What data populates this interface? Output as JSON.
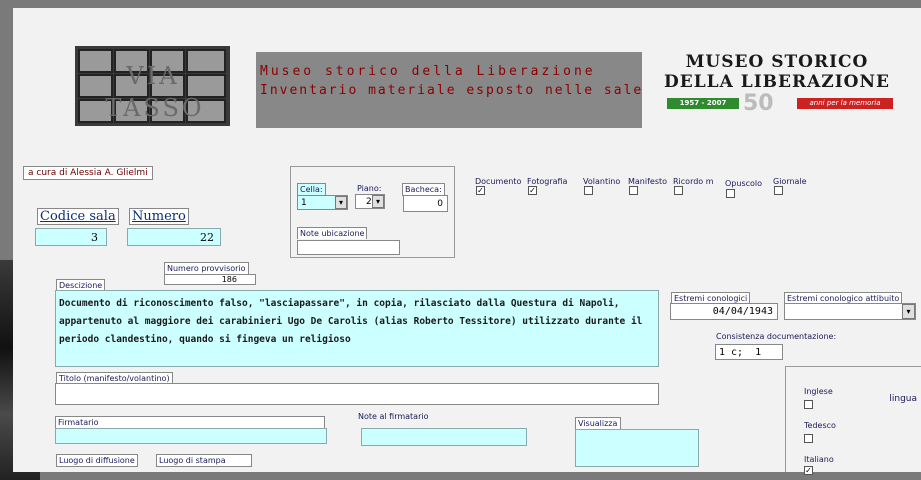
{
  "header": {
    "logo_text": "VIA TASSO",
    "title_line1": "Museo storico della Liberazione",
    "title_line2": "Inventario materiale esposto nelle sale",
    "brand": {
      "line1": "MUSEO STORICO",
      "line2": "DELLA LIBERAZIONE",
      "years": "1957 - 2007",
      "fifty": "50",
      "tagline": "anni per la memoria"
    }
  },
  "credit": "a cura di Alessia A. Glielmi",
  "location": {
    "cella_label": "Cella:",
    "cella_value": "1",
    "piano_label": "Piano:",
    "piano_value": "2",
    "bacheca_label": "Bacheca:",
    "bacheca_value": "0",
    "note_label": "Note ubicazione",
    "note_value": ""
  },
  "categories": [
    {
      "label": "Documento",
      "checked": true
    },
    {
      "label": "Fotografia",
      "checked": true
    },
    {
      "label": "Volantino",
      "checked": false
    },
    {
      "label": "Manifesto",
      "checked": false
    },
    {
      "label": "Ricordo m",
      "checked": false
    },
    {
      "label": "Opuscolo",
      "checked": false
    },
    {
      "label": "Giornale",
      "checked": false
    }
  ],
  "codice": {
    "label": "Codice sala",
    "value": "3"
  },
  "numero": {
    "label": "Numero",
    "value": "22"
  },
  "numero_provvisorio": {
    "label": "Numero provvisorio",
    "value": "186"
  },
  "descrizione": {
    "label": "Descizione",
    "text": "Documento di riconoscimento falso, \"lasciapassare\", in copia, rilasciato dalla Questura di Napoli, appartenuto al maggiore dei carabinieri Ugo De Carolis (alias Roberto Tessitore) utilizzato durante il periodo clandestino, quando si fingeva un religioso"
  },
  "estremi": {
    "label": "Estremi conologici",
    "value": "04/04/1943"
  },
  "estremi_attrib": {
    "label": "Estremi conologico attibuito",
    "value": ""
  },
  "consistenza": {
    "label": "Consistenza documentazione:",
    "value": "1 c;  1"
  },
  "titolo": {
    "label": "Titolo (manifesto/volantino)",
    "value": ""
  },
  "firmatario": {
    "label": "Firmatario",
    "value": ""
  },
  "note_firmatario": {
    "label": "Note al firmatario",
    "value": ""
  },
  "visualizza": {
    "label": "Visualizza"
  },
  "luogo_diffusione": {
    "label": "Luogo di diffusione"
  },
  "luogo_stampa": {
    "label": "Luogo di stampa"
  },
  "lingua": {
    "label": "lingua",
    "options": [
      {
        "label": "Inglese",
        "checked": false
      },
      {
        "label": "Tedesco",
        "checked": false
      },
      {
        "label": "Italiano",
        "checked": true
      }
    ]
  },
  "colors": {
    "title_red": "#8b0000",
    "field_cyan": "#ccffff",
    "link_blue": "#0b2e7a"
  }
}
